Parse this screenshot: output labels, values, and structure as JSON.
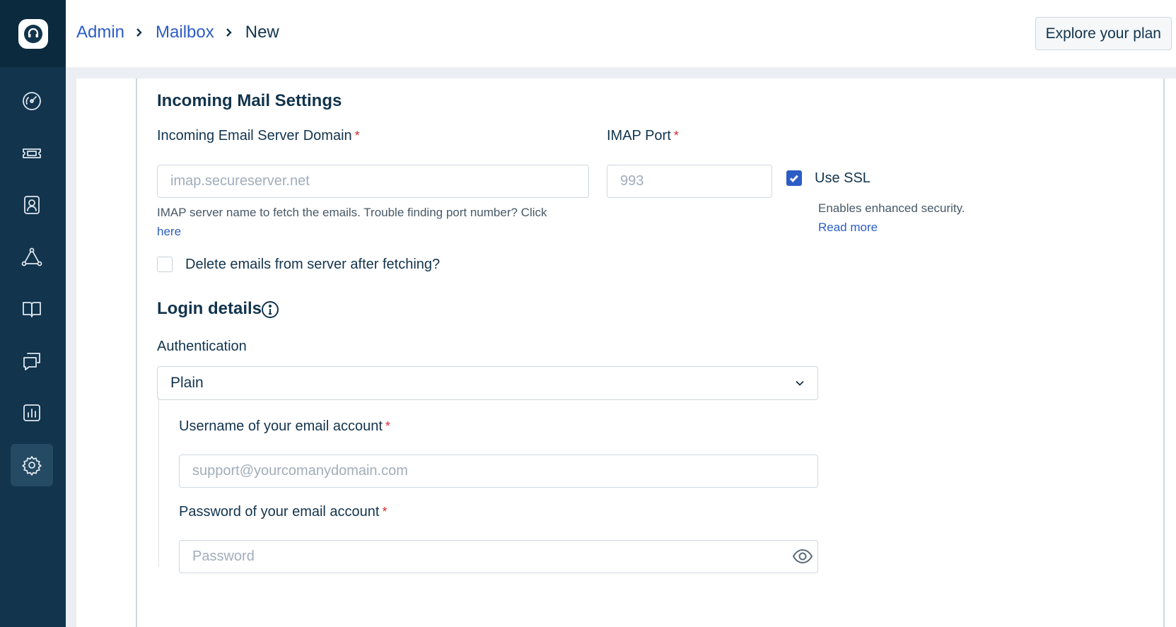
{
  "breadcrumb": {
    "items": [
      {
        "label": "Admin",
        "link": true
      },
      {
        "label": "Mailbox",
        "link": true
      },
      {
        "label": "New",
        "link": false
      }
    ]
  },
  "header": {
    "explore_label": "Explore your plan"
  },
  "sidebar": {
    "items": [
      {
        "name": "dashboard",
        "icon": "gauge-icon",
        "active": false
      },
      {
        "name": "tickets",
        "icon": "ticket-icon",
        "active": false
      },
      {
        "name": "contacts",
        "icon": "contact-card-icon",
        "active": false
      },
      {
        "name": "groups",
        "icon": "network-icon",
        "active": false
      },
      {
        "name": "solutions",
        "icon": "book-icon",
        "active": false
      },
      {
        "name": "forums",
        "icon": "chat-bubbles-icon",
        "active": false
      },
      {
        "name": "reports",
        "icon": "bar-chart-icon",
        "active": false
      },
      {
        "name": "admin",
        "icon": "gear-icon",
        "active": true
      }
    ]
  },
  "incoming": {
    "title": "Incoming Mail Settings",
    "domain_label": "Incoming Email Server Domain",
    "domain_placeholder": "imap.secureserver.net",
    "domain_hint": "IMAP server name to fetch the emails. Trouble finding port number? Click",
    "domain_hint_link": "here",
    "port_label": "IMAP Port",
    "port_placeholder": "993",
    "ssl_label": "Use SSL",
    "ssl_checked": true,
    "ssl_hint": "Enables enhanced security.",
    "ssl_link": "Read more",
    "delete_label": "Delete emails from server after fetching?",
    "delete_checked": false,
    "required_mark": "*"
  },
  "login": {
    "title": "Login details",
    "auth_label": "Authentication",
    "auth_value": "Plain",
    "username_label": "Username of your email account",
    "username_placeholder": "support@yourcomanydomain.com",
    "password_label": "Password of your email account",
    "password_placeholder": "Password"
  },
  "colors": {
    "sidebar": "#12344d",
    "accent": "#2c5cc5",
    "required": "#d72d30"
  }
}
